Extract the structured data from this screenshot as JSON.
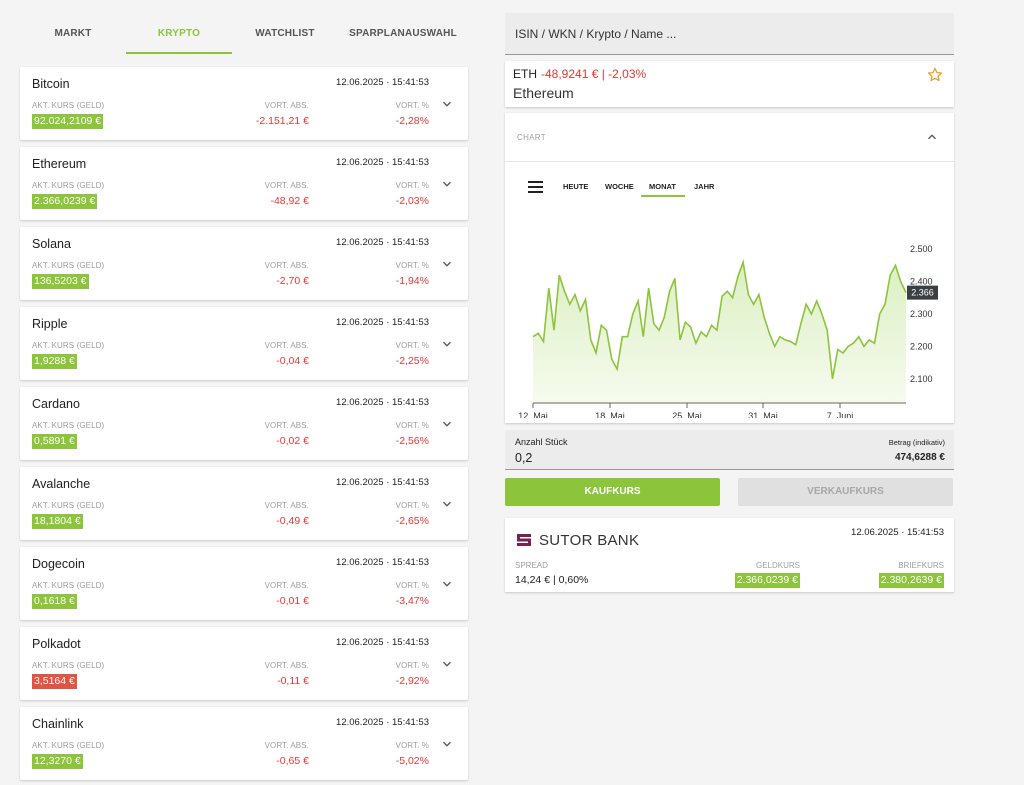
{
  "tabs": [
    {
      "label": "MARKT"
    },
    {
      "label": "KRYPTO",
      "active": true
    },
    {
      "label": "WATCHLIST"
    },
    {
      "label": "SPARPLANAUSWAHL"
    }
  ],
  "list": {
    "label_price": "AKT. KURS (GELD)",
    "label_abs": "VORT. ABS.",
    "label_pct": "VORT. %",
    "items": [
      {
        "name": "Bitcoin",
        "timestamp": "12.06.2025 · 15:41:53",
        "price": "92.024,2109 €",
        "abs": "-2.151,21 €",
        "pct": "-2,28%",
        "price_state": "up"
      },
      {
        "name": "Ethereum",
        "timestamp": "12.06.2025 · 15:41:53",
        "price": "2.366,0239 €",
        "abs": "-48,92 €",
        "pct": "-2,03%",
        "price_state": "up"
      },
      {
        "name": "Solana",
        "timestamp": "12.06.2025 · 15:41:53",
        "price": "136,5203 €",
        "abs": "-2,70 €",
        "pct": "-1,94%",
        "price_state": "up"
      },
      {
        "name": "Ripple",
        "timestamp": "12.06.2025 · 15:41:53",
        "price": "1,9288 €",
        "abs": "-0,04 €",
        "pct": "-2,25%",
        "price_state": "up"
      },
      {
        "name": "Cardano",
        "timestamp": "12.06.2025 · 15:41:53",
        "price": "0,5891 €",
        "abs": "-0,02 €",
        "pct": "-2,56%",
        "price_state": "up"
      },
      {
        "name": "Avalanche",
        "timestamp": "12.06.2025 · 15:41:53",
        "price": "18,1804 €",
        "abs": "-0,49 €",
        "pct": "-2,65%",
        "price_state": "up"
      },
      {
        "name": "Dogecoin",
        "timestamp": "12.06.2025 · 15:41:53",
        "price": "0,1618 €",
        "abs": "-0,01 €",
        "pct": "-3,47%",
        "price_state": "up"
      },
      {
        "name": "Polkadot",
        "timestamp": "12.06.2025 · 15:41:53",
        "price": "3,5164 €",
        "abs": "-0,11 €",
        "pct": "-2,92%",
        "price_state": "down"
      },
      {
        "name": "Chainlink",
        "timestamp": "12.06.2025 · 15:41:53",
        "price": "12,3270 €",
        "abs": "-0,65 €",
        "pct": "-5,02%",
        "price_state": "up"
      }
    ]
  },
  "search": {
    "placeholder": "ISIN / WKN / Krypto / Name ..."
  },
  "detail": {
    "symbol": "ETH",
    "change": "-48,9241 € | -2,03%",
    "name": "Ethereum",
    "star_icon": "star-outline-icon"
  },
  "chart_panel": {
    "title": "CHART",
    "ranges": [
      "HEUTE",
      "WOCHE",
      "MONAT",
      "JAHR"
    ],
    "active_range": "MONAT"
  },
  "chart_data": {
    "type": "area",
    "x_ticks": [
      "12. Mai",
      "18. Mai",
      "25. Mai",
      "31. Mai",
      "7. Juni"
    ],
    "y_ticks": [
      "2.500",
      "2.400",
      "2.300",
      "2.200",
      "2.100"
    ],
    "ylim": [
      2050,
      2550
    ],
    "last_value_label": "2.366",
    "values": [
      2230,
      2240,
      2215,
      2380,
      2250,
      2420,
      2370,
      2330,
      2360,
      2310,
      2345,
      2220,
      2180,
      2265,
      2250,
      2160,
      2130,
      2230,
      2230,
      2300,
      2340,
      2230,
      2380,
      2270,
      2250,
      2290,
      2370,
      2410,
      2220,
      2275,
      2260,
      2210,
      2245,
      2230,
      2265,
      2250,
      2355,
      2370,
      2350,
      2415,
      2460,
      2360,
      2330,
      2360,
      2290,
      2240,
      2200,
      2230,
      2220,
      2215,
      2205,
      2270,
      2330,
      2300,
      2340,
      2300,
      2250,
      2100,
      2190,
      2180,
      2200,
      2210,
      2230,
      2200,
      2220,
      2210,
      2300,
      2330,
      2420,
      2450,
      2400,
      2366
    ],
    "line_color": "#8cc43c",
    "fill_color": "#dcefc2"
  },
  "order": {
    "qty_label": "Anzahl Stück",
    "qty_value": "0,2",
    "amount_label": "Betrag (indikativ)",
    "amount_value": "474,6288 €",
    "buy_label": "KAUFKURS",
    "sell_label": "VERKAUFKURS"
  },
  "bank": {
    "name": "SUTOR BANK",
    "timestamp": "12.06.2025 · 15:41:53",
    "spread_label": "SPREAD",
    "spread_value": "14,24 € | 0,60%",
    "bid_label": "GELDKURS",
    "bid_value": "2.366,0239 €",
    "ask_label": "BRIEFKURS",
    "ask_value": "2.380,2639 €",
    "logo_color": "#7a2150"
  },
  "colors": {
    "accent": "#8cc43c",
    "negative": "#e53935",
    "price_down_bg": "#e05444"
  }
}
